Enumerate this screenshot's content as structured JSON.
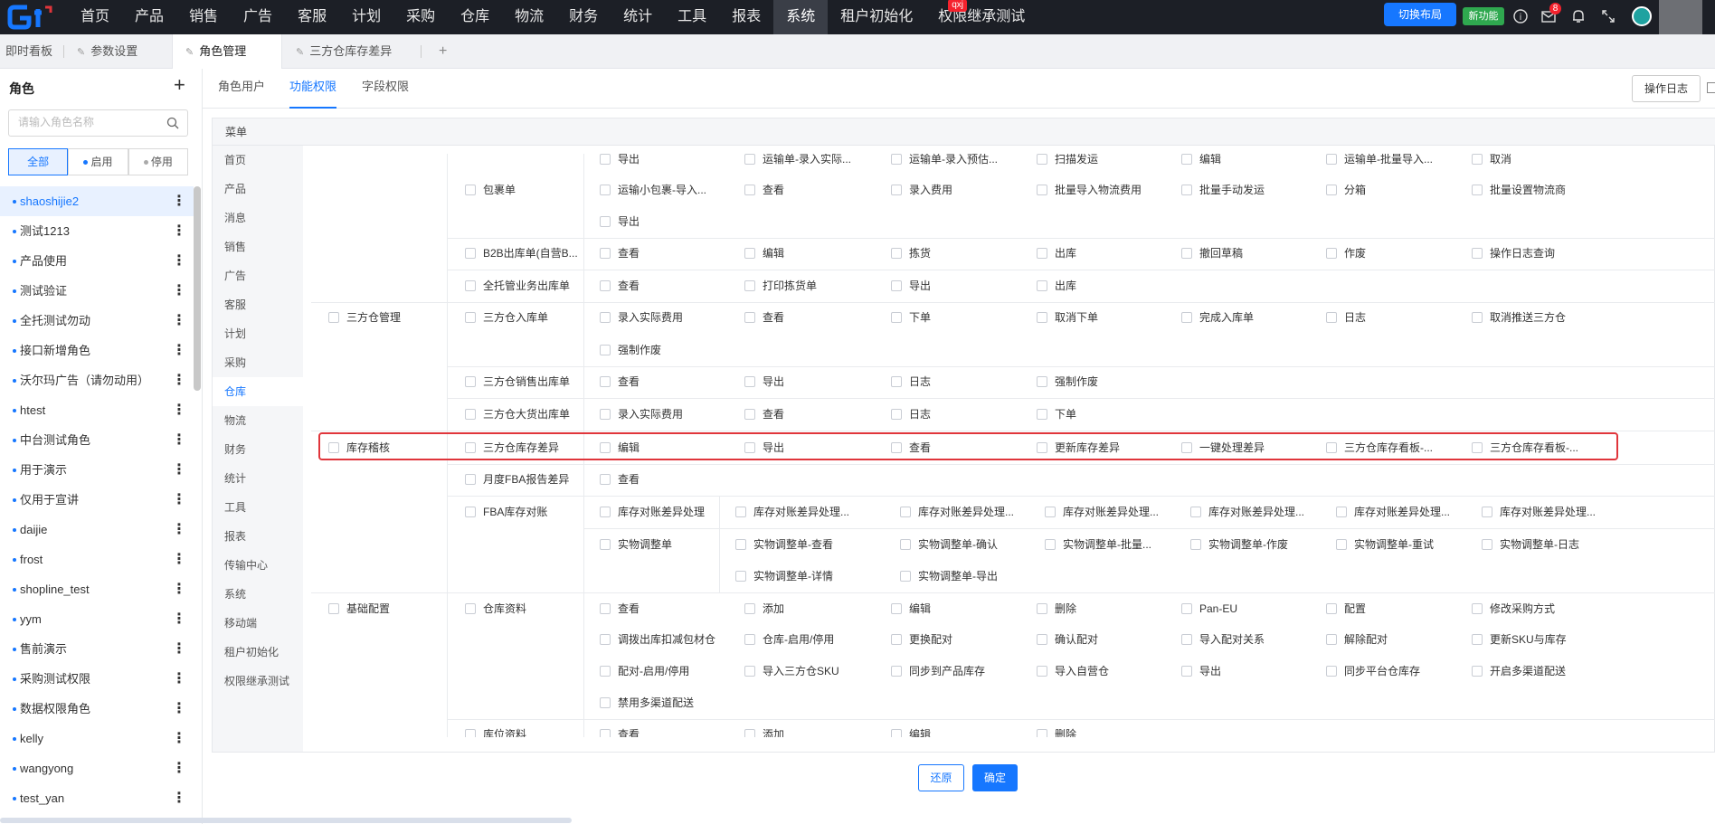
{
  "topbar": {
    "nav": [
      "首页",
      "产品",
      "销售",
      "广告",
      "客服",
      "计划",
      "采购",
      "仓库",
      "物流",
      "财务",
      "统计",
      "工具",
      "报表",
      "系统",
      "租户初始化",
      "权限继承测试"
    ],
    "active_nav": "系统",
    "nav_badge": "qxj",
    "switch_layout": "切换布局",
    "new_feature": "新功能",
    "notice_count": "8",
    "accent": "#1677ff"
  },
  "tabs": {
    "items": [
      "即时看板",
      "参数设置",
      "角色管理",
      "三方仓库存差异"
    ],
    "active": "角色管理",
    "add": "+"
  },
  "left": {
    "title": "角色",
    "add": "+",
    "search_placeholder": "请输入角色名称",
    "filters": [
      "全部",
      "启用",
      "停用"
    ],
    "roles": [
      "shaoshijie2",
      "测试1213",
      "产品使用",
      "测试验证",
      "全托测试勿动",
      "接口新增角色",
      "沃尔玛广告（请勿动用）",
      "htest",
      "中台测试角色",
      "用于演示",
      "仅用于宣讲",
      "daijie",
      "frost",
      "shopline_test",
      "yym",
      "售前演示",
      "采购测试权限",
      "数据权限角色",
      "kelly",
      "wangyong",
      "test_yan"
    ],
    "more_icon": "⋮"
  },
  "subtabs": {
    "items": [
      "角色用户",
      "功能权限",
      "字段权限"
    ],
    "active": "功能权限",
    "operation_log": "操作日志"
  },
  "panel": {
    "header": "菜单",
    "menu": [
      "首页",
      "产品",
      "消息",
      "销售",
      "广告",
      "客服",
      "计划",
      "采购",
      "仓库",
      "物流",
      "财务",
      "统计",
      "工具",
      "报表",
      "传输中心",
      "系统",
      "移动端",
      "租户初始化",
      "权限继承测试"
    ],
    "active_menu": "仓库"
  },
  "table": {
    "top_partial": [
      "导出",
      "运输单-录入实际...",
      "运输单-录入预估...",
      "扫描发运",
      "编辑",
      "运输单-批量导入...",
      "取消"
    ],
    "package": {
      "name": "包裹单",
      "rows": [
        [
          "运输小包裹-导入...",
          "查看",
          "录入费用",
          "批量导入物流费用",
          "批量手动发运",
          "分箱",
          "批量设置物流商"
        ],
        [
          "导出"
        ]
      ]
    },
    "b2b": {
      "name": "B2B出库单(自营B...",
      "perms": [
        "查看",
        "编辑",
        "拣货",
        "出库",
        "撤回草稿",
        "作废",
        "操作日志查询"
      ]
    },
    "fulltrust": {
      "name": "全托管业务出库单",
      "perms": [
        "查看",
        "打印拣货单",
        "导出",
        "出库"
      ]
    },
    "third_party": {
      "group": "三方仓管理",
      "inbound": {
        "name": "三方仓入库单",
        "rows": [
          [
            "录入实际费用",
            "查看",
            "下单",
            "取消下单",
            "完成入库单",
            "日志",
            "取消推送三方仓"
          ],
          [
            "强制作废"
          ]
        ]
      },
      "sales_out": {
        "name": "三方仓销售出库单",
        "perms": [
          "查看",
          "导出",
          "日志",
          "强制作废"
        ]
      },
      "bulk_out": {
        "name": "三方仓大货出库单",
        "perms": [
          "录入实际费用",
          "查看",
          "日志",
          "下单"
        ]
      }
    },
    "inventory_check": {
      "group": "库存稽核",
      "diff": {
        "name": "三方仓库存差异",
        "perms": [
          "编辑",
          "导出",
          "查看",
          "更新库存差异",
          "一键处理差异",
          "三方仓库存看板-...",
          "三方仓库存看板-..."
        ]
      },
      "fba_month": {
        "name": "月度FBA报告差异",
        "perms": [
          "查看"
        ]
      },
      "fba_recon": {
        "name": "FBA库存对账",
        "sub1": {
          "name": "库存对账差异处理",
          "perms": [
            "库存对账差异处理...",
            "库存对账差异处理...",
            "库存对账差异处理...",
            "库存对账差异处理...",
            "库存对账差异处理...",
            "库存对账差异处理..."
          ]
        },
        "sub2": {
          "name": "实物调整单",
          "rows": [
            [
              "实物调整单-查看",
              "实物调整单-确认",
              "实物调整单-批量...",
              "实物调整单-作废",
              "实物调整单-重试",
              "实物调整单-日志"
            ],
            [
              "实物调整单-详情",
              "实物调整单-导出"
            ]
          ]
        }
      }
    },
    "base_config": {
      "group": "基础配置",
      "warehouse": {
        "name": "仓库资料",
        "rows": [
          [
            "查看",
            "添加",
            "编辑",
            "删除",
            "Pan-EU",
            "配置",
            "修改采购方式"
          ],
          [
            "调拨出库扣减包材仓",
            "仓库-启用/停用",
            "更换配对",
            "确认配对",
            "导入配对关系",
            "解除配对",
            "更新SKU与库存"
          ],
          [
            "配对-启用/停用",
            "导入三方仓SKU",
            "同步到产品库存",
            "导入自营仓",
            "导出",
            "同步平台仓库存",
            "开启多渠道配送"
          ],
          [
            "禁用多渠道配送"
          ]
        ]
      },
      "location": {
        "name": "库位资料",
        "perms": [
          "查看",
          "添加",
          "编辑",
          "删除"
        ]
      }
    }
  },
  "footer": {
    "restore": "还原",
    "confirm": "确定"
  }
}
